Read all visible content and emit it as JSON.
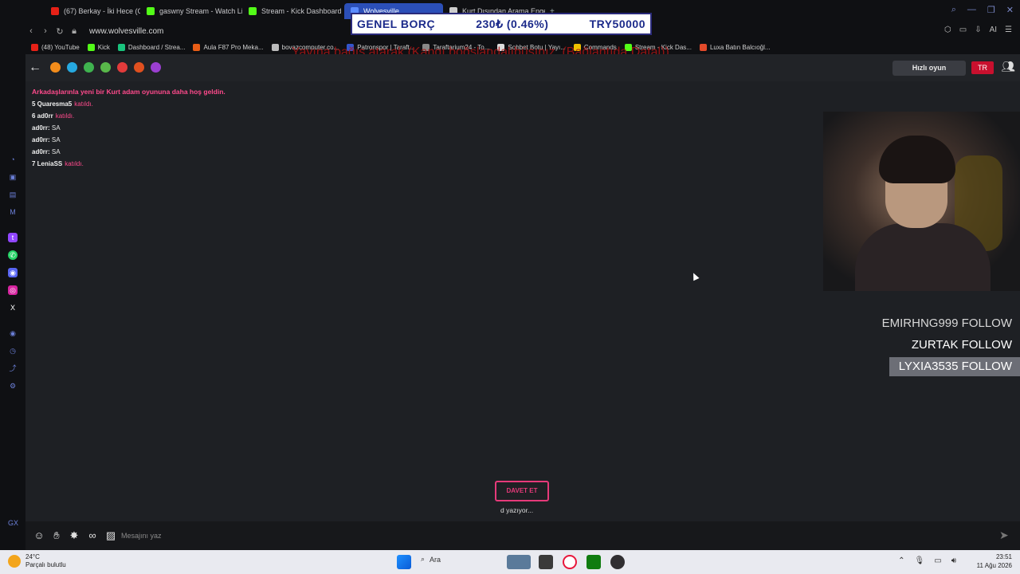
{
  "browser": {
    "tabs": [
      {
        "label": "(67) Berkay - İki Hece (Offi",
        "color": "#e62117"
      },
      {
        "label": "gaswny Stream - Watch Li",
        "color": "#53fc18"
      },
      {
        "label": "Stream - Kick Dashboard",
        "color": "#53fc18"
      },
      {
        "label": "Wolvesville",
        "color": "#5b8cff"
      },
      {
        "label": "Kurt Dışından Arama Engel",
        "color": "#cccccc"
      }
    ],
    "url": "www.wolvesville.com",
    "bookmarks": [
      {
        "label": "(48) YouTube",
        "color": "#e62117"
      },
      {
        "label": "Kick",
        "color": "#53fc18"
      },
      {
        "label": "Dashboard / Strea...",
        "color": "#19c37d"
      },
      {
        "label": "Aula F87 Pro Meka...",
        "color": "#e85d16"
      },
      {
        "label": "bovazcomputer.co...",
        "color": "#bbbbbb"
      },
      {
        "label": "Patronspor | Taraft...",
        "color": "#3355cc"
      },
      {
        "label": "Taraftarium24 - To...",
        "color": "#888888"
      },
      {
        "label": "Sohbet Botu | Yayı...",
        "color": "#dddddd"
      },
      {
        "label": "Commands",
        "color": "#f0c000"
      },
      {
        "label": "Stream - Kick Das...",
        "color": "#53fc18"
      },
      {
        "label": "Luxa Batın Balcıoğl...",
        "color": "#e24a2a"
      }
    ]
  },
  "overlay": {
    "banner_label": "GENEL BORÇ",
    "banner_change": "230₺ (0.46%)",
    "banner_total": "TRY50000",
    "red_text": "Yayına bağış atarak (Kangı boğslandalıbüsınız. (Bağlantıda Datal))"
  },
  "game": {
    "quick_play": "Hızlı oyun",
    "flag_label": "TR",
    "chat": {
      "welcome": "Arkadaşlarınla yeni bir Kurt adam oyununa daha hoş geldin.",
      "lines": [
        {
          "user": "5 Quaresma5",
          "text": "katıldı.",
          "type": "join"
        },
        {
          "user": "6 ad0rr",
          "text": "katıldı.",
          "type": "join"
        },
        {
          "user": "ad0rr:",
          "text": "SA",
          "type": "msg"
        },
        {
          "user": "ad0rr:",
          "text": "SA",
          "type": "msg"
        },
        {
          "user": "ad0rr:",
          "text": "SA",
          "type": "msg"
        },
        {
          "user": "7 LeniaSS",
          "text": "katıldı.",
          "type": "join"
        }
      ]
    },
    "follows": [
      {
        "name": "EMIRHNG999",
        "action": "FOLLOW"
      },
      {
        "name": "ZURTAK",
        "action": "FOLLOW"
      },
      {
        "name": "LYXIA3535",
        "action": "FOLLOW"
      }
    ],
    "invite_label": "DAVET ET",
    "typing": "d yazıyor...",
    "message_placeholder": "Mesajını yaz"
  },
  "taskbar": {
    "temperature": "24°C",
    "weather": "Parçalı bulutlu",
    "search": "Ara",
    "time": "23:51",
    "date": "11 Ağu 2026"
  }
}
